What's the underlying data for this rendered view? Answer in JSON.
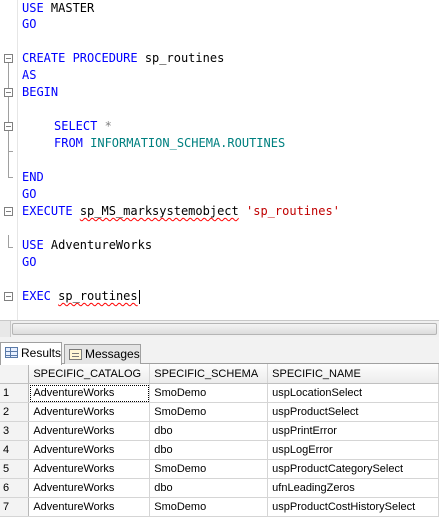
{
  "editor": {
    "lines": {
      "use_master": {
        "kw": "USE",
        "rest": " MASTER"
      },
      "go1": {
        "kw": "GO"
      },
      "create": {
        "kw": "CREATE PROCEDURE",
        "rest": " sp_routines"
      },
      "as": {
        "kw": "AS"
      },
      "begin": {
        "kw": "BEGIN"
      },
      "select": {
        "kw": "SELECT",
        "star": " *"
      },
      "from": {
        "kw": "FROM",
        "obj": " INFORMATION_SCHEMA.ROUTINES"
      },
      "end": {
        "kw": "END"
      },
      "go2": {
        "kw": "GO"
      },
      "execute": {
        "kw": "EXECUTE",
        "sp": "sp_MS_marksystemobject",
        "str": "'sp_routines'"
      },
      "use_aw": {
        "kw": "USE",
        "rest": " AdventureWorks"
      },
      "go3": {
        "kw": "GO"
      },
      "exec": {
        "kw": "EXEC",
        "rest": "sp_routines"
      }
    }
  },
  "results": {
    "tabs": {
      "results": "Results",
      "messages": "Messages"
    },
    "columns": [
      "SPECIFIC_CATALOG",
      "SPECIFIC_SCHEMA",
      "SPECIFIC_NAME"
    ],
    "rows": [
      {
        "n": "1",
        "catalog": "AdventureWorks",
        "schema": "SmoDemo",
        "name": "uspLocationSelect"
      },
      {
        "n": "2",
        "catalog": "AdventureWorks",
        "schema": "SmoDemo",
        "name": "uspProductSelect"
      },
      {
        "n": "3",
        "catalog": "AdventureWorks",
        "schema": "dbo",
        "name": "uspPrintError"
      },
      {
        "n": "4",
        "catalog": "AdventureWorks",
        "schema": "dbo",
        "name": "uspLogError"
      },
      {
        "n": "5",
        "catalog": "AdventureWorks",
        "schema": "SmoDemo",
        "name": "uspProductCategorySelect"
      },
      {
        "n": "6",
        "catalog": "AdventureWorks",
        "schema": "dbo",
        "name": "ufnLeadingZeros"
      },
      {
        "n": "7",
        "catalog": "AdventureWorks",
        "schema": "SmoDemo",
        "name": "uspProductCostHistorySelect"
      }
    ]
  },
  "colors": {
    "keyword": "#0000ff",
    "operator": "#808080",
    "system_object": "#008080",
    "string": "#c00000"
  }
}
